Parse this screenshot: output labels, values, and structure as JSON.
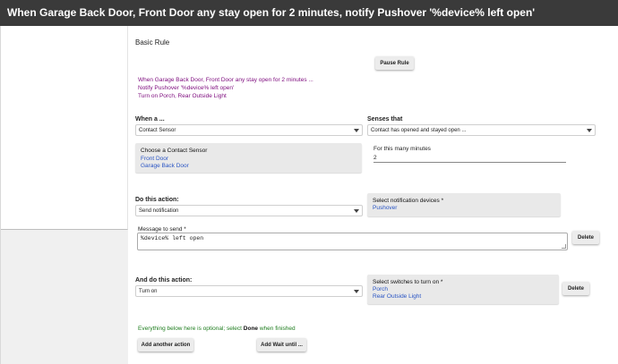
{
  "window": {
    "title": "When Garage Back Door, Front Door any stay open for 2 minutes, notify Pushover '%device% left open'"
  },
  "rule": {
    "heading": "Basic Rule",
    "pause_label": "Pause Rule",
    "summary": [
      "When Garage Back Door, Front Door any stay open for 2 minutes ...",
      "Notify Pushover '%device% left open'",
      "Turn on Porch, Rear Outside Light"
    ]
  },
  "trigger": {
    "when_label": "When a ...",
    "when_value": "Contact Sensor",
    "senses_label": "Senses that",
    "senses_value": "Contact has opened and stayed open ...",
    "choose_label": "Choose a Contact Sensor",
    "devices": [
      "Front Door",
      "Garage Back Door"
    ],
    "minutes_label": "For this many minutes",
    "minutes_value": "2"
  },
  "action1": {
    "label": "Do this action:",
    "value": "Send notification",
    "notify_label": "Select notification devices *",
    "notify_device": "Pushover",
    "message_label": "Message to send *",
    "message_value": "%device% left open",
    "delete_label": "Delete"
  },
  "action2": {
    "label": "And do this action:",
    "value": "Turn on",
    "switches_label": "Select switches to turn on *",
    "switches": [
      "Porch",
      "Rear Outside Light"
    ],
    "delete_label": "Delete"
  },
  "footer": {
    "optional_pre": "Everything below here is optional; select ",
    "optional_bold": "Done",
    "optional_post": " when finished",
    "add_action_label": "Add another action",
    "add_wait_label": "Add Wait until ..."
  }
}
